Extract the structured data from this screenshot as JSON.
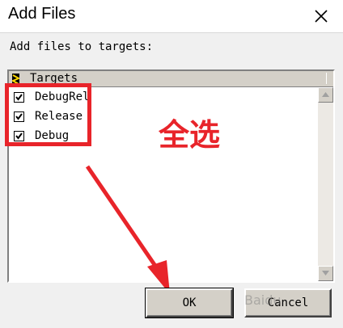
{
  "window": {
    "title": "Add Files"
  },
  "dialog": {
    "prompt": "Add files to targets:"
  },
  "list": {
    "header": "Targets",
    "items": [
      {
        "label": "DebugRel",
        "checked": true
      },
      {
        "label": "Release",
        "checked": true
      },
      {
        "label": "Debug",
        "checked": true
      }
    ]
  },
  "annotation": {
    "text": "全选",
    "color": "#e8242a"
  },
  "buttons": {
    "ok": "OK",
    "cancel": "Cancel"
  },
  "watermark": {
    "text": "Baidu"
  }
}
